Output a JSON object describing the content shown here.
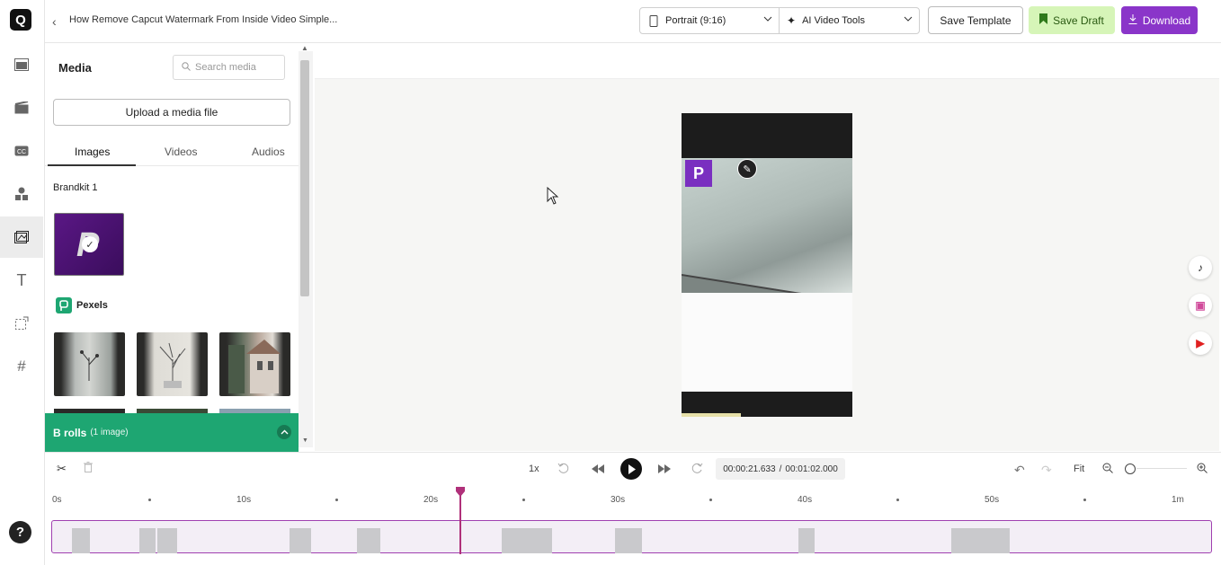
{
  "topbar": {
    "title": "How Remove Capcut Watermark From Inside Video Simple...",
    "aspect_label": "Portrait (9:16)",
    "tools_label": "AI Video Tools",
    "save_template": "Save Template",
    "save_draft": "Save Draft",
    "download": "Download"
  },
  "media": {
    "title": "Media",
    "search_placeholder": "Search media",
    "upload_label": "Upload a media file",
    "tabs": [
      "Images",
      "Videos",
      "Audios"
    ],
    "brandkit_label": "Brandkit 1",
    "pexels_label": "Pexels",
    "brolls_label": "B rolls",
    "brolls_count": "(1 image)"
  },
  "playback": {
    "speed": "1x",
    "current_time": "00:00:21.633",
    "separator": "/",
    "total_time": "00:01:02.000",
    "fit_label": "Fit"
  },
  "timeline": {
    "ticks": [
      "0s",
      "10s",
      "20s",
      "30s",
      "40s",
      "50s",
      "1m"
    ],
    "playhead_seconds": 21.633
  },
  "colors": {
    "accent": "#8a35c9",
    "draft_bg": "#d6f5b8",
    "broll_green": "#1ea672",
    "playhead": "#b0307a"
  },
  "icons": [
    "logo-icon",
    "layout-icon",
    "scenes-icon",
    "captions-icon",
    "elements-icon",
    "media-icon",
    "text-icon",
    "resize-icon",
    "hashtag-icon",
    "help-icon",
    "tiktok-icon",
    "reels-icon",
    "shorts-icon"
  ]
}
